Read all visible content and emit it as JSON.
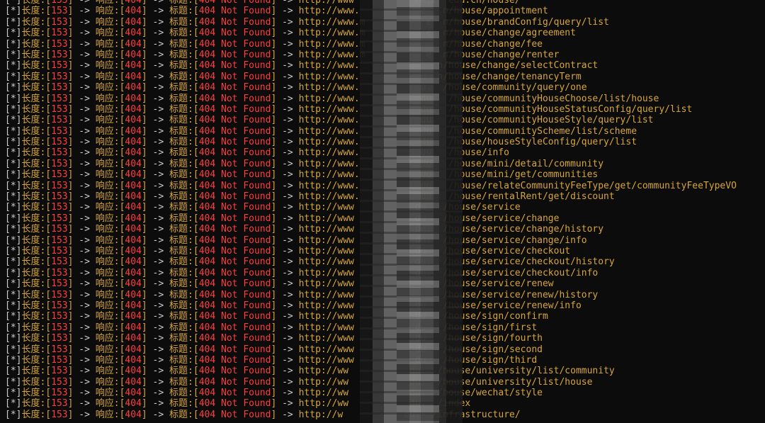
{
  "segments": {
    "bracket_open": "[",
    "star": "*",
    "bracket_close": "]",
    "length_label": "长度:[",
    "length_value": "153",
    "length_close": "]",
    "arrow": " -> ",
    "response_label": "响应:[",
    "response_value": "404",
    "response_close": "]",
    "title_label": "标题:[",
    "title_value": "404 Not Found",
    "title_close": "]"
  },
  "lines": [
    {
      "prefix": "http://www",
      "suffix": "me.z  edu.cn/house/"
    },
    {
      "prefix": "http://www.",
      "suffix": "e   n/house/appointment"
    },
    {
      "prefix": "http://www.m",
      "suffix": "e  n/house/brandConfig/query/list"
    },
    {
      "prefix": "http://www.m",
      "suffix": "e  n/house/change/agreement"
    },
    {
      "prefix": "http://www.m",
      "suffix": "   n/house/change/fee"
    },
    {
      "prefix": "http://www.m",
      "suffix": "e  n/house/change/renter"
    },
    {
      "prefix": "http://www.",
      "suffix": "   n/house/change/selectContract"
    },
    {
      "prefix": "http://www.",
      "suffix": "u  n/house/change/tenancyTerm"
    },
    {
      "prefix": "http://www.",
      "suffix": "u.  /house/community/query/one"
    },
    {
      "prefix": "http://www.",
      "suffix": "du.  /house/communityHouseChoose/list/house"
    },
    {
      "prefix": "http://www.",
      "suffix": "du.  /house/communityHouseStatusConfig/query/list"
    },
    {
      "prefix": "http://www.",
      "suffix": "du.  /house/communityHouseStyle/query/list"
    },
    {
      "prefix": "http://www.",
      "suffix": "du.  /house/communityScheme/list/scheme"
    },
    {
      "prefix": "http://www.",
      "suffix": "du.  /house/houseStyleConfig/query/list"
    },
    {
      "prefix": "http://www.",
      "suffix": "du.  /house/info"
    },
    {
      "prefix": "http://www.",
      "suffix": "du.  /house/mini/detail/community"
    },
    {
      "prefix": "http://www.",
      "suffix": "du.  /house/mini/get/communities"
    },
    {
      "prefix": "http://www.",
      "suffix": "du.  /house/relateCommunityFeeType/get/communityFeeTypeVO"
    },
    {
      "prefix": "http://www.",
      "suffix": "du.  /house/rentalRent/get/discount"
    },
    {
      "prefix": "http://www",
      "suffix": "du   /house/service"
    },
    {
      "prefix": "http://www",
      "suffix": "du   /house/service/change"
    },
    {
      "prefix": "http://www",
      "suffix": "du.  /house/service/change/history"
    },
    {
      "prefix": "http://www",
      "suffix": "du.  /house/service/change/info"
    },
    {
      "prefix": "http://www",
      "suffix": "du   /house/service/checkout"
    },
    {
      "prefix": "http://www",
      "suffix": "du.  /house/service/checkout/history"
    },
    {
      "prefix": "http://www",
      "suffix": "du.  /house/service/checkout/info"
    },
    {
      "prefix": "http://www",
      "suffix": "     /house/service/renew"
    },
    {
      "prefix": "http://www",
      "suffix": "     /house/service/renew/history"
    },
    {
      "prefix": "http://www",
      "suffix": "du   /house/service/renew/info"
    },
    {
      "prefix": "http://www",
      "suffix": "du   /house/sign/confirm"
    },
    {
      "prefix": "http://www",
      "suffix": "du   /house/sign/first"
    },
    {
      "prefix": "http://www",
      "suffix": "du   /house/sign/fourth"
    },
    {
      "prefix": "http://www",
      "suffix": "du   /house/sign/second"
    },
    {
      "prefix": "http://www",
      "suffix": "du   /house/sign/third"
    },
    {
      "prefix": "http://ww",
      "suffix": "du.  /house/university/list/community"
    },
    {
      "prefix": "http://ww",
      "suffix": "du.  /house/university/list/house"
    },
    {
      "prefix": "http://ww",
      "suffix": "du.  /house/wechat/style"
    },
    {
      "prefix": "http://ww",
      "suffix": "du.  /index"
    },
    {
      "prefix": "http://w",
      "suffix": "du.  /infrastructure/"
    }
  ]
}
